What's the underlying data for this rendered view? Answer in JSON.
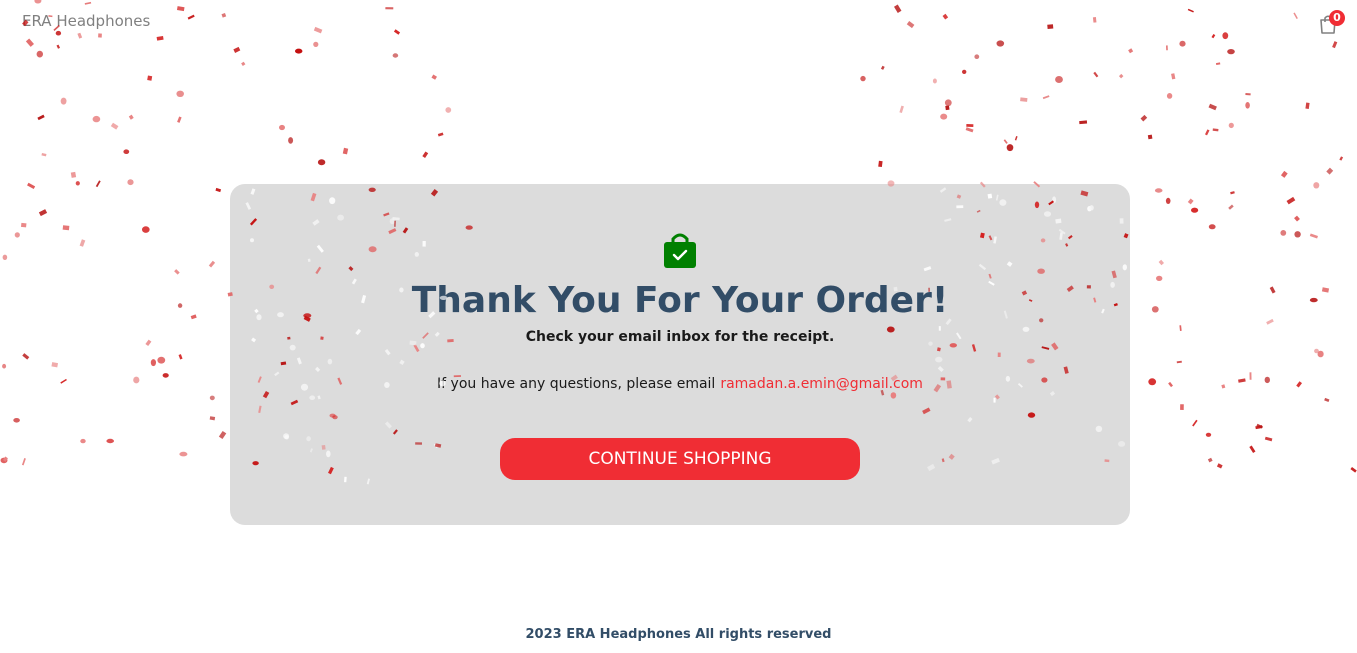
{
  "navbar": {
    "logo": "ERA Headphones",
    "cart_icon": "shopping-bag-icon",
    "cart_count": "0"
  },
  "success": {
    "icon": "shopping-bag-check-icon",
    "title": "Thank You For Your Order!",
    "subtitle": "Check your email inbox for the receipt.",
    "questions_text": "If you have any questions, please email",
    "email": "ramadan.a.emin@gmail.com",
    "button_label": "CONTINUE SHOPPING"
  },
  "footer": {
    "text": "2023 ERA Headphones All rights reserved"
  },
  "colors": {
    "accent": "#f02d34",
    "heading": "#324d67",
    "card_background": "#dcdcdc",
    "success_icon": "#008000",
    "confetti_dark": "#c41010",
    "confetti_light": "#e06060"
  }
}
